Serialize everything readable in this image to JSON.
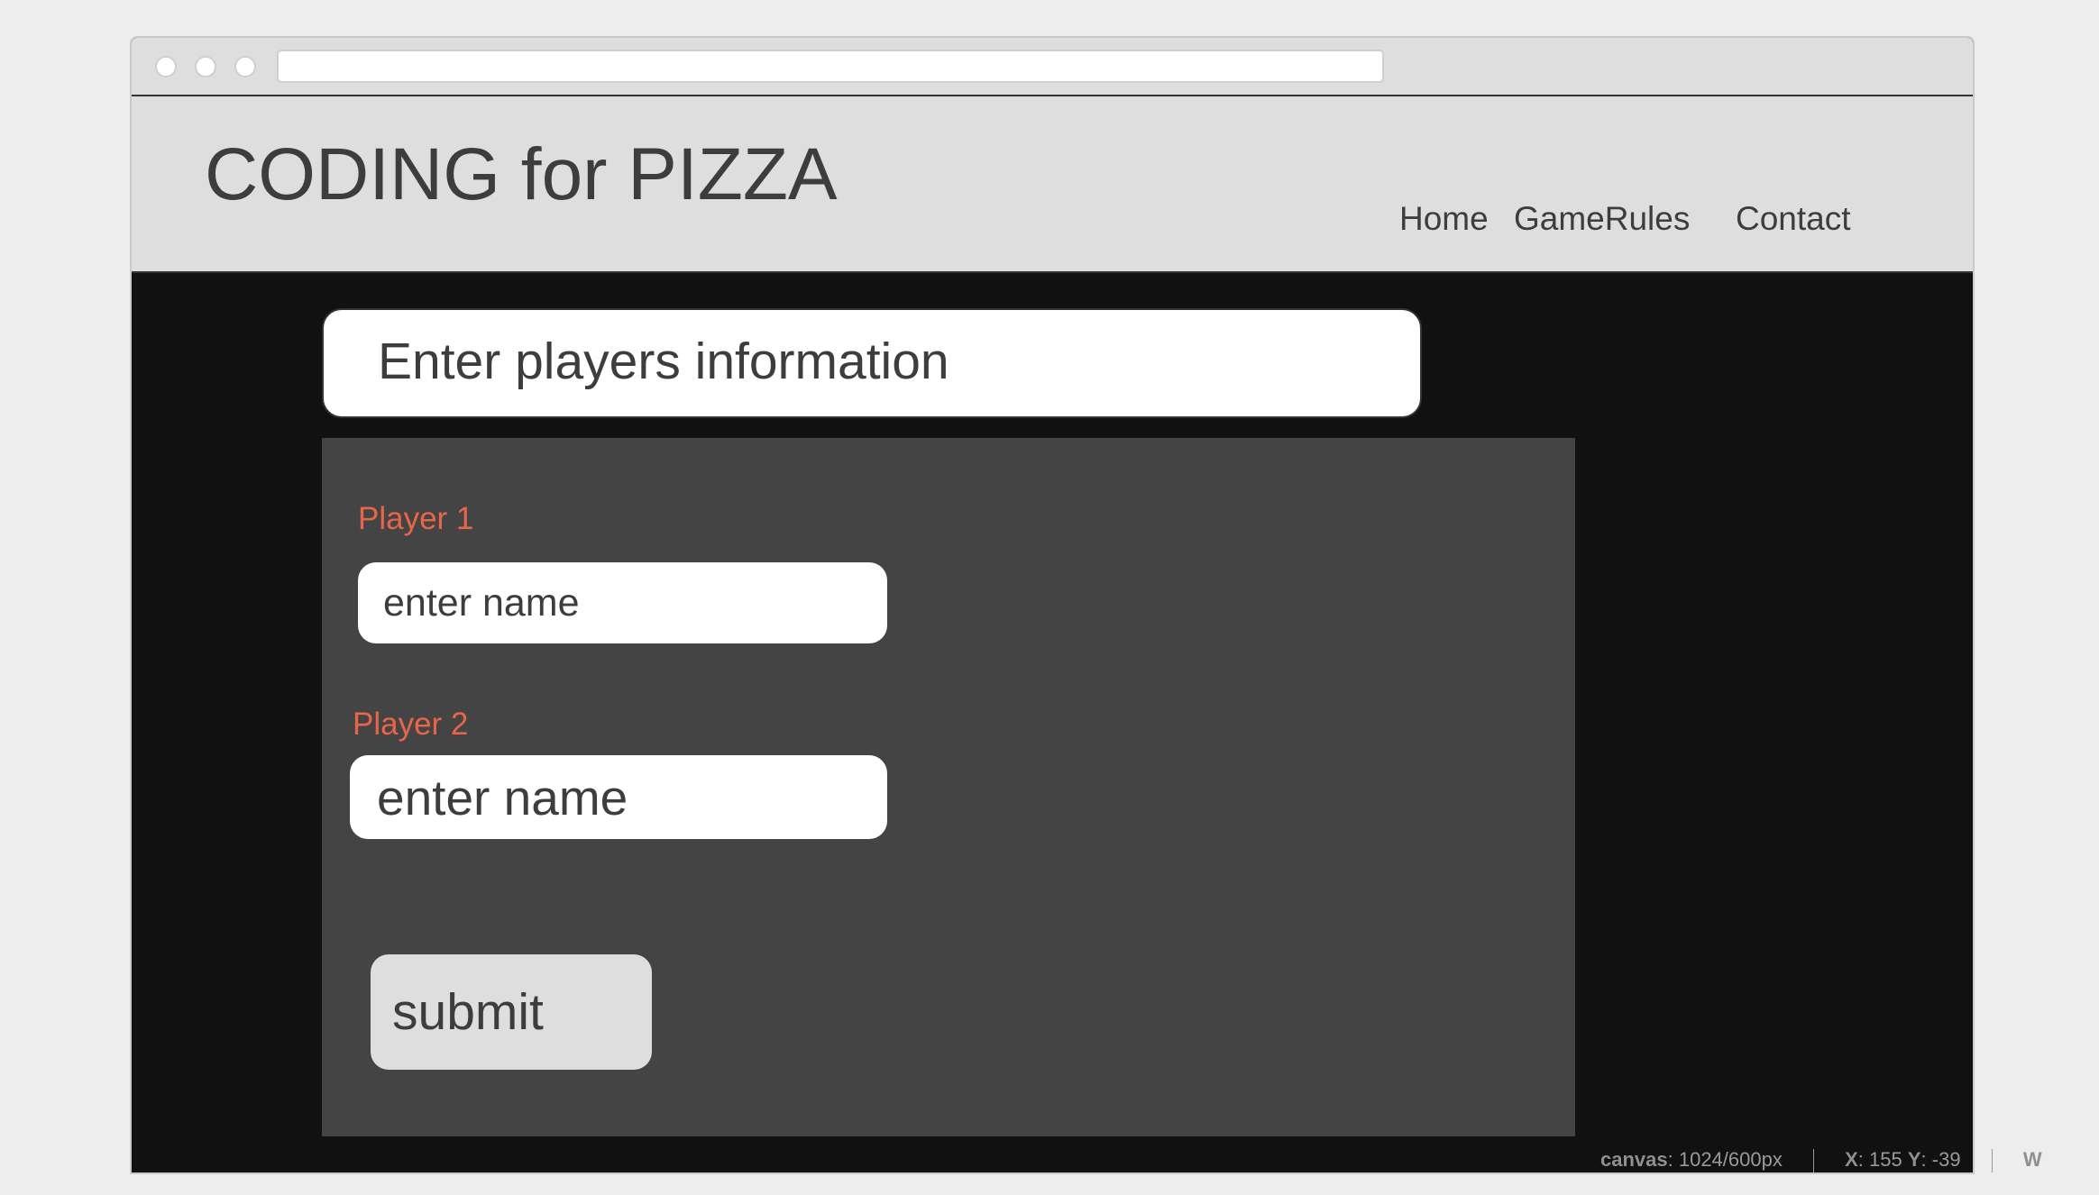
{
  "window": {
    "url": ""
  },
  "header": {
    "brand": "CODING for PIZZA",
    "nav": [
      "Home",
      "GameRules",
      "Contact"
    ]
  },
  "main": {
    "title": "Enter players information",
    "players": [
      {
        "label": "Player 1",
        "placeholder": "enter name",
        "value": ""
      },
      {
        "label": "Player 2",
        "placeholder": "enter name",
        "value": ""
      }
    ],
    "submit_label": "submit"
  },
  "status_bar": {
    "canvas_label": "canvas",
    "canvas_value": ": 1024/600px",
    "x_label": "X",
    "x_value": ": 155",
    "y_label": "Y",
    "y_value": ": -39",
    "w_label": "W"
  },
  "colors": {
    "accent_label": "#e8654a",
    "panel": "#444444",
    "page": "#111111",
    "header": "#dedede"
  }
}
